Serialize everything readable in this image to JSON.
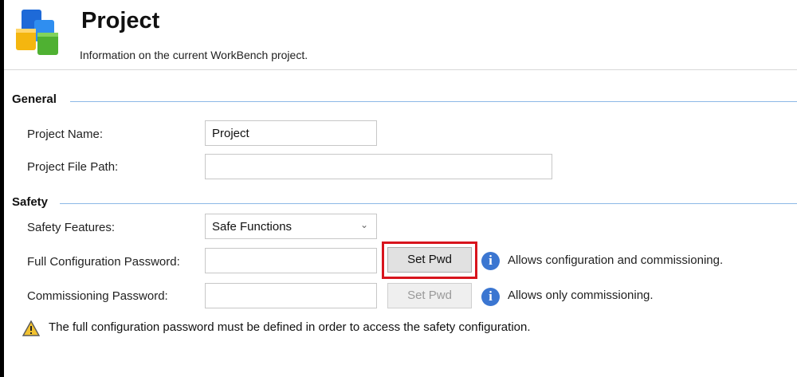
{
  "header": {
    "title": "Project",
    "subtitle": "Information on the current WorkBench project."
  },
  "sections": {
    "general": "General",
    "safety": "Safety"
  },
  "fields": {
    "project_name_label": "Project Name:",
    "project_name_value": "Project",
    "project_file_path_label": "Project File Path:",
    "project_file_path_value": "",
    "safety_features_label": "Safety Features:",
    "safety_features_value": "Safe Functions",
    "full_config_password_label": "Full Configuration Password:",
    "full_config_password_value": "",
    "commissioning_password_label": "Commissioning Password:",
    "commissioning_password_value": ""
  },
  "buttons": {
    "set_pwd_full": "Set Pwd",
    "set_pwd_commissioning": "Set Pwd"
  },
  "info": {
    "full_config": "Allows configuration and commissioning.",
    "commissioning": "Allows only commissioning."
  },
  "warning": {
    "text": "The full configuration password must be defined in order to access the safety configuration."
  },
  "colors": {
    "accent_line": "#8cb8e6",
    "highlight": "#d8141d",
    "info_icon": "#3b76d1",
    "warning_icon": "#f2c230"
  },
  "icons": {
    "logo": "stacked-cubes-icon",
    "info": "info-icon",
    "warning": "warning-triangle-icon",
    "dropdown": "chevron-down-icon"
  }
}
